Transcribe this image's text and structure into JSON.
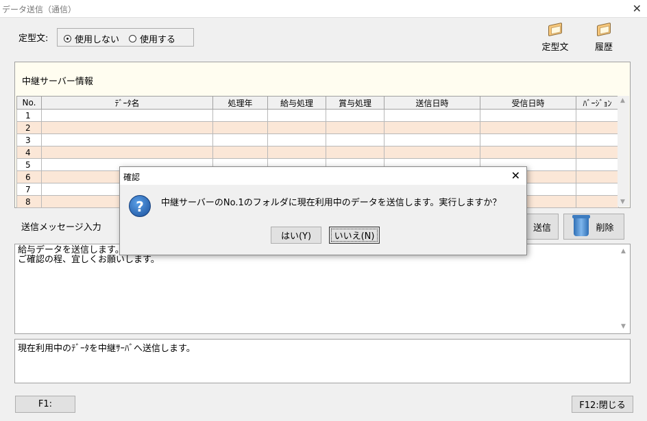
{
  "window": {
    "title": "データ送信（通信）",
    "close": "✕"
  },
  "template": {
    "label": "定型文:",
    "options": [
      "使用しない",
      "使用する"
    ],
    "selected": 0
  },
  "toolbar": {
    "teikei_label": "定型文",
    "history_label": "履歴"
  },
  "server_panel": {
    "title": "中継サーバー情報",
    "columns": [
      "No.",
      "ﾃﾞｰﾀ名",
      "処理年",
      "給与処理",
      "賞与処理",
      "送信日時",
      "受信日時",
      "ﾊﾞｰｼﾞｮﾝ"
    ],
    "rows": [
      "1",
      "2",
      "3",
      "4",
      "5",
      "6",
      "7",
      "8"
    ]
  },
  "message": {
    "label": "送信メッセージ入力",
    "send_label": "送信",
    "delete_label": "削除",
    "text_line1": "給与データを送信します。",
    "text_line2": "ご確認の程、宜しくお願いします。"
  },
  "status_text": "現在利用中のﾃﾞｰﾀを中継ｻｰﾊﾞへ送信します。",
  "footer": {
    "f1_label": "F1:",
    "f12_label": "F12:閉じる"
  },
  "dialog": {
    "title": "確認",
    "close": "✕",
    "icon": "?",
    "message": "中継サーバーのNo.1のフォルダに現在利用中のデータを送信します。実行しますか？",
    "yes_label": "はい(Y)",
    "no_label": "いいえ(N)"
  }
}
